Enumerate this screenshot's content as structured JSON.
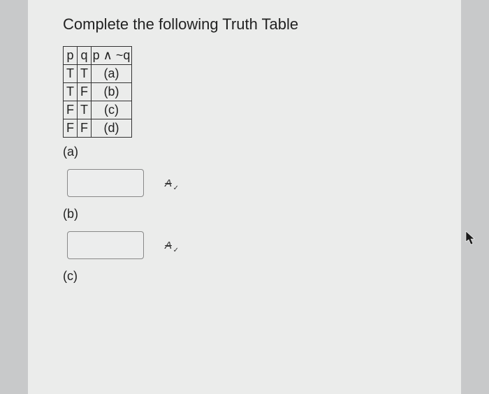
{
  "title": "Complete the following Truth Table",
  "table": {
    "header": {
      "p": "p",
      "q": "q",
      "expr": "p ∧ ~q"
    },
    "rows": [
      {
        "p": "T",
        "q": "T",
        "ans": "(a)"
      },
      {
        "p": "T",
        "q": "F",
        "ans": "(b)"
      },
      {
        "p": "F",
        "q": "T",
        "ans": "(c)"
      },
      {
        "p": "F",
        "q": "F",
        "ans": "(d)"
      }
    ]
  },
  "answers": {
    "a_label": "(a)",
    "b_label": "(b)",
    "c_label": "(c)",
    "a_value": "",
    "b_value": ""
  }
}
